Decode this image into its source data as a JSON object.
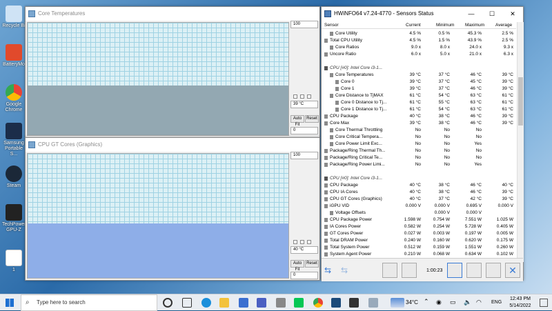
{
  "desktop": {
    "icons": [
      "Recycle Bi",
      "BatteryMo",
      "Google Chrome",
      "Samsung Portable S...",
      "Steam",
      "TechPower GPU-Z",
      "1"
    ]
  },
  "core_temp_win": {
    "title": "Core Temperatures",
    "top_label": "100",
    "value": "39 °C",
    "bottom_label": "0",
    "auto": "Auto Fit",
    "reset": "Reset",
    "fill_level": 0.44
  },
  "gpu_win": {
    "title": "CPU GT Cores (Graphics)",
    "top_label": "100",
    "value": "40 °C",
    "bottom_label": "0",
    "auto": "Auto Fit",
    "reset": "Reset",
    "fill_level": 0.44
  },
  "hwinfo": {
    "title": "HWiNFO64 v7.24-4770 - Sensors Status",
    "headers": {
      "sensor": "Sensor",
      "current": "Current",
      "minimum": "Minimum",
      "maximum": "Maximum",
      "average": "Average"
    },
    "rows": [
      {
        "n": "Core Utility",
        "c": "4.5 %",
        "mi": "0.5 %",
        "ma": "45.3 %",
        "av": "2.5 %",
        "ind": 1
      },
      {
        "n": "Total CPU Utility",
        "c": "4.5 %",
        "mi": "1.5 %",
        "ma": "43.9 %",
        "av": "2.5 %",
        "ind": 0
      },
      {
        "n": "Core Ratios",
        "c": "9.0 x",
        "mi": "8.0 x",
        "ma": "24.0 x",
        "av": "9.3 x",
        "ind": 1
      },
      {
        "n": "Uncore Ratio",
        "c": "6.0 x",
        "mi": "5.0 x",
        "ma": "21.0 x",
        "av": "6.3 x",
        "ind": 0
      },
      {
        "n": "",
        "c": "",
        "mi": "",
        "ma": "",
        "av": "",
        "ind": 0
      },
      {
        "n": "CPU [#0]: Intel Core i3-1...",
        "c": "",
        "mi": "",
        "ma": "",
        "av": "",
        "ind": 0,
        "sec": true
      },
      {
        "n": "Core Temperatures",
        "c": "39 °C",
        "mi": "37 °C",
        "ma": "46 °C",
        "av": "39 °C",
        "ind": 1
      },
      {
        "n": "Core 0",
        "c": "39 °C",
        "mi": "37 °C",
        "ma": "45 °C",
        "av": "39 °C",
        "ind": 2
      },
      {
        "n": "Core 1",
        "c": "39 °C",
        "mi": "37 °C",
        "ma": "46 °C",
        "av": "39 °C",
        "ind": 2
      },
      {
        "n": "Core Distance to TjMAX",
        "c": "61 °C",
        "mi": "54 °C",
        "ma": "63 °C",
        "av": "61 °C",
        "ind": 1
      },
      {
        "n": "Core 0 Distance to Tj...",
        "c": "61 °C",
        "mi": "55 °C",
        "ma": "63 °C",
        "av": "61 °C",
        "ind": 2
      },
      {
        "n": "Core 1 Distance to Tj...",
        "c": "61 °C",
        "mi": "54 °C",
        "ma": "63 °C",
        "av": "61 °C",
        "ind": 2
      },
      {
        "n": "CPU Package",
        "c": "40 °C",
        "mi": "38 °C",
        "ma": "46 °C",
        "av": "39 °C",
        "ind": 0
      },
      {
        "n": "Core Max",
        "c": "39 °C",
        "mi": "38 °C",
        "ma": "46 °C",
        "av": "39 °C",
        "ind": 0
      },
      {
        "n": "Core Thermal Throttling",
        "c": "No",
        "mi": "No",
        "ma": "No",
        "av": "",
        "ind": 1
      },
      {
        "n": "Core Critical Tempera...",
        "c": "No",
        "mi": "No",
        "ma": "No",
        "av": "",
        "ind": 1
      },
      {
        "n": "Core Power Limit Exc...",
        "c": "No",
        "mi": "No",
        "ma": "Yes",
        "av": "",
        "ind": 1
      },
      {
        "n": "Package/Ring Thermal Th...",
        "c": "No",
        "mi": "No",
        "ma": "No",
        "av": "",
        "ind": 0
      },
      {
        "n": "Package/Ring Critical Te...",
        "c": "No",
        "mi": "No",
        "ma": "No",
        "av": "",
        "ind": 0
      },
      {
        "n": "Package/Ring Power Limi...",
        "c": "No",
        "mi": "No",
        "ma": "Yes",
        "av": "",
        "ind": 0
      },
      {
        "n": "",
        "c": "",
        "mi": "",
        "ma": "",
        "av": "",
        "ind": 0
      },
      {
        "n": "CPU [#0]: Intel Core i3-1...",
        "c": "",
        "mi": "",
        "ma": "",
        "av": "",
        "ind": 0,
        "sec": true
      },
      {
        "n": "CPU Package",
        "c": "40 °C",
        "mi": "38 °C",
        "ma": "46 °C",
        "av": "40 °C",
        "ind": 0
      },
      {
        "n": "CPU IA Cores",
        "c": "40 °C",
        "mi": "38 °C",
        "ma": "46 °C",
        "av": "39 °C",
        "ind": 0
      },
      {
        "n": "CPU GT Cores (Graphics)",
        "c": "40 °C",
        "mi": "37 °C",
        "ma": "42 °C",
        "av": "39 °C",
        "ind": 0
      },
      {
        "n": "iGPU VID",
        "c": "0.000 V",
        "mi": "0.000 V",
        "ma": "0.695 V",
        "av": "0.000 V",
        "ind": 0
      },
      {
        "n": "Voltage Offsets",
        "c": "",
        "mi": "0.000 V",
        "ma": "0.000 V",
        "av": "",
        "ind": 1
      },
      {
        "n": "CPU Package Power",
        "c": "1.598 W",
        "mi": "0.754 W",
        "ma": "7.551 W",
        "av": "1.025 W",
        "ind": 0
      },
      {
        "n": "IA Cores Power",
        "c": "0.582 W",
        "mi": "0.254 W",
        "ma": "5.728 W",
        "av": "0.405 W",
        "ind": 0
      },
      {
        "n": "GT Cores Power",
        "c": "0.027 W",
        "mi": "0.003 W",
        "ma": "0.197 W",
        "av": "0.005 W",
        "ind": 0
      },
      {
        "n": "Total DRAM Power",
        "c": "0.240 W",
        "mi": "0.160 W",
        "ma": "0.620 W",
        "av": "0.175 W",
        "ind": 0
      },
      {
        "n": "Total System Power",
        "c": "0.512 W",
        "mi": "0.159 W",
        "ma": "1.551 W",
        "av": "0.260 W",
        "ind": 0
      },
      {
        "n": "System Agent Power",
        "c": "0.210 W",
        "mi": "0.068 W",
        "ma": "0.634 W",
        "av": "0.102 W",
        "ind": 0
      }
    ],
    "timer": "1:00:23"
  },
  "taskbar": {
    "search": "Type here to search",
    "temp": "34°C",
    "lang": "ENG",
    "time": "12:43 PM",
    "date": "5/14/2022"
  },
  "colors": {
    "graph_bg": "#dcf0f5",
    "graph_fill_temp": "#93a8b2",
    "graph_fill_gpu": "#8eaee8"
  }
}
